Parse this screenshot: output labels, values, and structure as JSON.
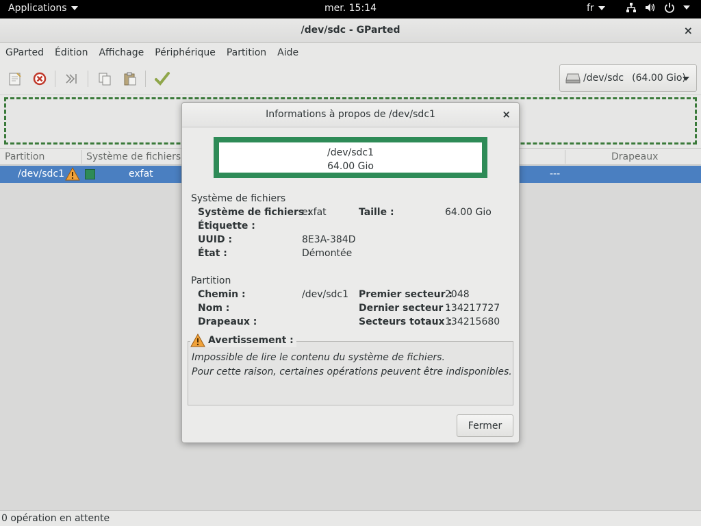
{
  "topbar": {
    "applications": "Applications",
    "clock": "mer. 15:14",
    "language": "fr"
  },
  "window": {
    "title": "/dev/sdc - GParted",
    "close": "×"
  },
  "menu": {
    "items": [
      "GParted",
      "Édition",
      "Affichage",
      "Périphérique",
      "Partition",
      "Aide"
    ]
  },
  "toolbar": {
    "device": "/dev/sdc",
    "device_size": "(64.00 Gio)"
  },
  "table": {
    "headers": {
      "partition": "Partition",
      "filesystem": "Système de fichiers",
      "flags": "Drapeaux"
    },
    "row": {
      "partition": "/dev/sdc1",
      "filesystem": "exfat",
      "flags": "---",
      "fs_color": "#2e8b57"
    }
  },
  "status": {
    "text": "0 opération en attente"
  },
  "dialog": {
    "title": "Informations à propos de /dev/sdc1",
    "close": "×",
    "visual": {
      "path": "/dev/sdc1",
      "size": "64.00 Gio",
      "border_color": "#2e8b57"
    },
    "filesystem_section": {
      "heading": "Système de fichiers",
      "fs_label": "Système de fichiers :",
      "fs_value": "exfat",
      "size_label": "Taille :",
      "size_value": "64.00 Gio",
      "label_label": "Étiquette :",
      "label_value": "",
      "uuid_label": "UUID :",
      "uuid_value": "8E3A-384D",
      "state_label": "État :",
      "state_value": "Démontée"
    },
    "partition_section": {
      "heading": "Partition",
      "path_label": "Chemin :",
      "path_value": "/dev/sdc1",
      "first_label": "Premier secteur :",
      "first_value": "2048",
      "name_label": "Nom :",
      "name_value": "",
      "last_label": "Dernier secteur :",
      "last_value": "134217727",
      "flags_label": "Drapeaux :",
      "flags_value": "",
      "total_label": "Secteurs totaux :",
      "total_value": "134215680"
    },
    "warning": {
      "legend": "Avertissement :",
      "line1": "Impossible de lire le contenu du système de fichiers.",
      "line2": "Pour cette raison, certaines opérations peuvent être indisponibles."
    },
    "close_button": "Fermer"
  }
}
